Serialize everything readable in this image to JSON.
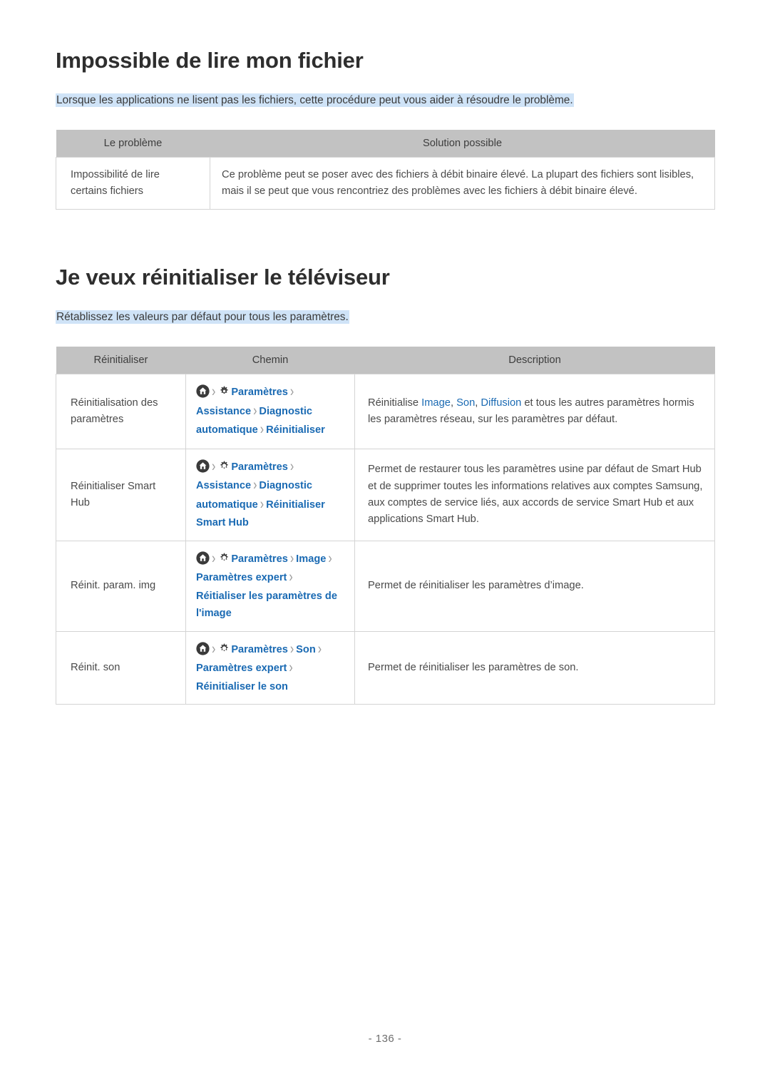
{
  "page": {
    "number_label": "- 136 -"
  },
  "sections": [
    {
      "title": "Impossible de lire mon fichier",
      "lead": "Lorsque les applications ne lisent pas les fichiers, cette procédure peut vous aider à résoudre le problème.",
      "table": {
        "headers": [
          "Le problème",
          "Solution possible"
        ],
        "rows": [
          {
            "problem": "Impossibilité de lire certains fichiers",
            "solution": "Ce problème peut se poser avec des fichiers à débit binaire élevé. La plupart des fichiers sont lisibles, mais il se peut que vous rencontriez des problèmes avec les fichiers à débit binaire élevé."
          }
        ]
      }
    },
    {
      "title": "Je veux réinitialiser le téléviseur",
      "lead": "Rétablissez les valeurs par défaut pour tous les paramètres.",
      "table": {
        "headers": [
          "Réinitialiser",
          "Chemin",
          "Description"
        ],
        "rows": [
          {
            "label": "Réinitialisation des paramètres",
            "path_icons": [
              "home-icon",
              "gear-icon"
            ],
            "path_segments": [
              "Paramètres",
              "Assistance",
              "Diagnostic automatique",
              "Réinitialiser"
            ],
            "desc_prefix": "Réinitialise ",
            "desc_links": [
              "Image",
              "Son",
              "Diffusion"
            ],
            "desc_suffix": " et tous les autres paramètres hormis les paramètres réseau, sur les paramètres par défaut."
          },
          {
            "label": "Réinitialiser Smart Hub",
            "path_icons": [
              "home-icon",
              "gear-icon"
            ],
            "path_segments": [
              "Paramètres",
              "Assistance",
              "Diagnostic automatique",
              "Réinitialiser Smart Hub"
            ],
            "desc": "Permet de restaurer tous les paramètres usine par défaut de Smart Hub et de supprimer toutes les informations relatives aux comptes Samsung, aux comptes de service liés, aux accords de service Smart Hub et aux applications Smart Hub."
          },
          {
            "label": "Réinit. param. img",
            "path_icons": [
              "home-icon",
              "gear-icon"
            ],
            "path_segments": [
              "Paramètres",
              "Image",
              "Paramètres expert",
              "Réitialiser les paramètres de l'image"
            ],
            "desc": "Permet de réinitialiser les paramètres d’image."
          },
          {
            "label": "Réinit. son",
            "path_icons": [
              "home-icon",
              "gear-icon"
            ],
            "path_segments": [
              "Paramètres",
              "Son",
              "Paramètres expert",
              "Réinitialiser le son"
            ],
            "desc": "Permet de réinitialiser les paramètres de son."
          }
        ]
      }
    }
  ],
  "colors": {
    "link": "#1a6ab3",
    "highlight": "#cfe3f7",
    "table_header_bg": "#c2c2c2",
    "text": "#4a4a4a",
    "chevron": "#9b9b9b"
  }
}
